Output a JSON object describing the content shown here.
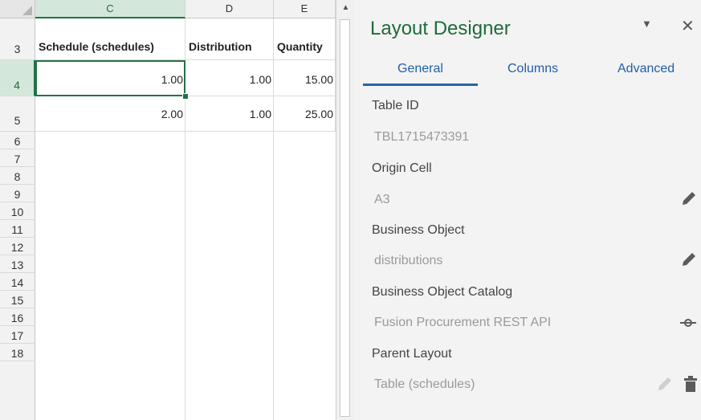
{
  "sheet": {
    "columns": [
      {
        "label": "C"
      },
      {
        "label": "D"
      },
      {
        "label": "E"
      }
    ],
    "rows": [
      "3",
      "4",
      "5",
      "6",
      "7",
      "8",
      "9",
      "10",
      "11",
      "12",
      "13",
      "14",
      "15",
      "16",
      "17",
      "18"
    ],
    "header_cells": [
      "Schedule (schedules)",
      "Distribution",
      "Quantity"
    ],
    "data_rows": [
      [
        "1.00",
        "1.00",
        "15.00"
      ],
      [
        "2.00",
        "1.00",
        "25.00"
      ]
    ]
  },
  "pane": {
    "title": "Layout Designer",
    "tabs": [
      "General",
      "Columns",
      "Advanced"
    ],
    "active_tab": "General",
    "fields": {
      "table_id": {
        "label": "Table ID",
        "value": "TBL1715473391"
      },
      "origin_cell": {
        "label": "Origin Cell",
        "value": "A3"
      },
      "business_object": {
        "label": "Business Object",
        "value": "distributions"
      },
      "catalog": {
        "label": "Business Object Catalog",
        "value": "Fusion Procurement REST API"
      },
      "parent_layout": {
        "label": "Parent Layout",
        "value": "Table (schedules)"
      }
    }
  },
  "colors": {
    "accent_green": "#217346",
    "title_green": "#1f6a3c",
    "tab_blue": "#2465a9"
  }
}
